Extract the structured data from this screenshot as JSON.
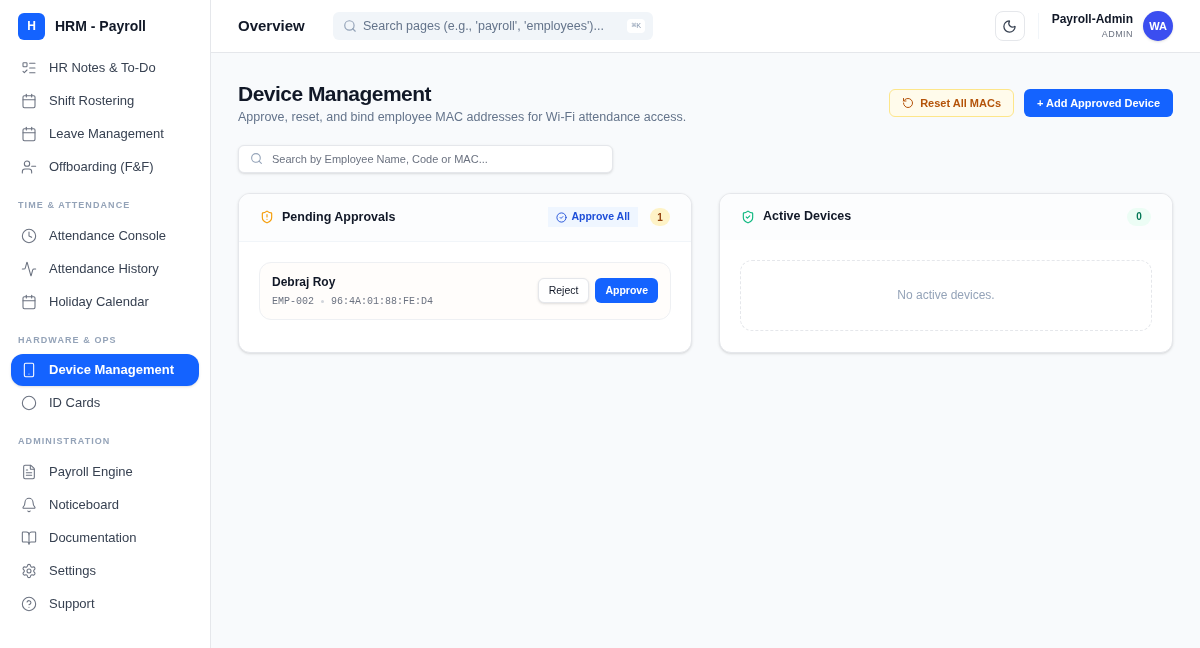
{
  "brand": {
    "logo_letter": "H",
    "name": "HRM - Payroll"
  },
  "sidebar": {
    "groups": [
      {
        "items": [
          {
            "label": "HR Notes & To-Do",
            "selected": false
          },
          {
            "label": "Shift Rostering",
            "selected": false
          },
          {
            "label": "Leave Management",
            "selected": false
          },
          {
            "label": "Offboarding (F&F)",
            "selected": false
          }
        ]
      },
      {
        "heading": "TIME & ATTENDANCE",
        "items": [
          {
            "label": "Attendance Console",
            "selected": false
          },
          {
            "label": "Attendance History",
            "selected": false
          },
          {
            "label": "Holiday Calendar",
            "selected": false
          }
        ]
      },
      {
        "heading": "HARDWARE & OPS",
        "items": [
          {
            "label": "Device Management",
            "selected": true
          },
          {
            "label": "ID Cards",
            "selected": false
          }
        ]
      },
      {
        "heading": "ADMINISTRATION",
        "items": [
          {
            "label": "Payroll Engine",
            "selected": false
          },
          {
            "label": "Noticeboard",
            "selected": false
          },
          {
            "label": "Documentation",
            "selected": false
          },
          {
            "label": "Settings",
            "selected": false
          },
          {
            "label": "Support",
            "selected": false
          }
        ]
      }
    ]
  },
  "header": {
    "title": "Overview",
    "search": {
      "placeholder": "Search pages (e.g., 'payroll', 'employees')...",
      "shortcut": "⌘K"
    },
    "user": {
      "name": "Payroll-Admin",
      "role": "ADMIN",
      "initials": "WA"
    }
  },
  "page": {
    "title": "Device Management",
    "subtitle": "Approve, reset, and bind employee MAC addresses for Wi-Fi attendance access.",
    "actions": [
      "Reset All MACs",
      "+ Add Approved Device"
    ],
    "search": {
      "placeholder": "Search by Employee Name, Code or MAC..."
    }
  },
  "pending": {
    "title": "Pending Approvals",
    "approve_all": "Approve All",
    "count": "1",
    "requests": [
      {
        "name": "Debraj Roy",
        "code": "EMP-002",
        "mac": "96:4A:01:88:FE:D4",
        "reject": "Reject",
        "approve": "Approve"
      }
    ]
  },
  "active": {
    "title": "Active Devices",
    "count": "0",
    "empty": "No active devices."
  }
}
